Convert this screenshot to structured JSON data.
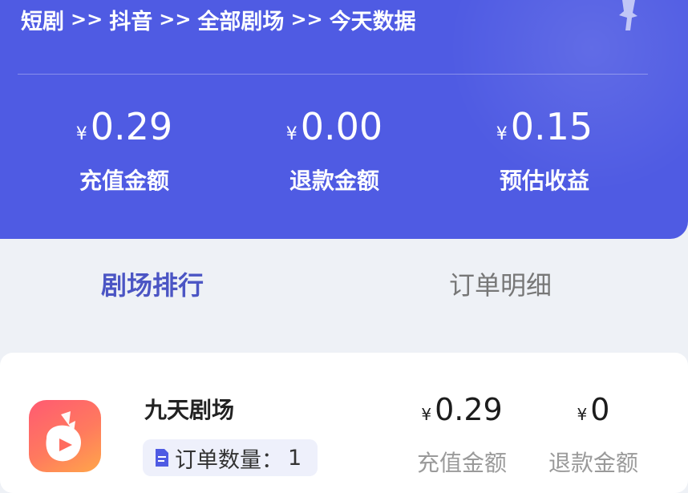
{
  "header": {
    "breadcrumb": [
      "短剧",
      "抖音",
      "全部剧场",
      "今天数据"
    ],
    "separator": ">>",
    "stats": [
      {
        "currency": "¥",
        "value": "0.29",
        "label": "充值金额"
      },
      {
        "currency": "¥",
        "value": "0.00",
        "label": "退款金额"
      },
      {
        "currency": "¥",
        "value": "0.15",
        "label": "预估收益"
      }
    ]
  },
  "tabs": [
    {
      "label": "剧场排行",
      "active": true
    },
    {
      "label": "订单明细",
      "active": false
    }
  ],
  "theater_list": [
    {
      "name": "九天剧场",
      "order_count_label": "订单数量：",
      "order_count": "1",
      "recharge": {
        "currency": "¥",
        "value": "0.29",
        "label": "充值金额"
      },
      "refund": {
        "currency": "¥",
        "value": "0",
        "label": "退款金额"
      }
    }
  ],
  "colors": {
    "header_bg": "#4f5be3",
    "active_tab": "#4b55c4",
    "page_bg": "#eef1f6"
  }
}
